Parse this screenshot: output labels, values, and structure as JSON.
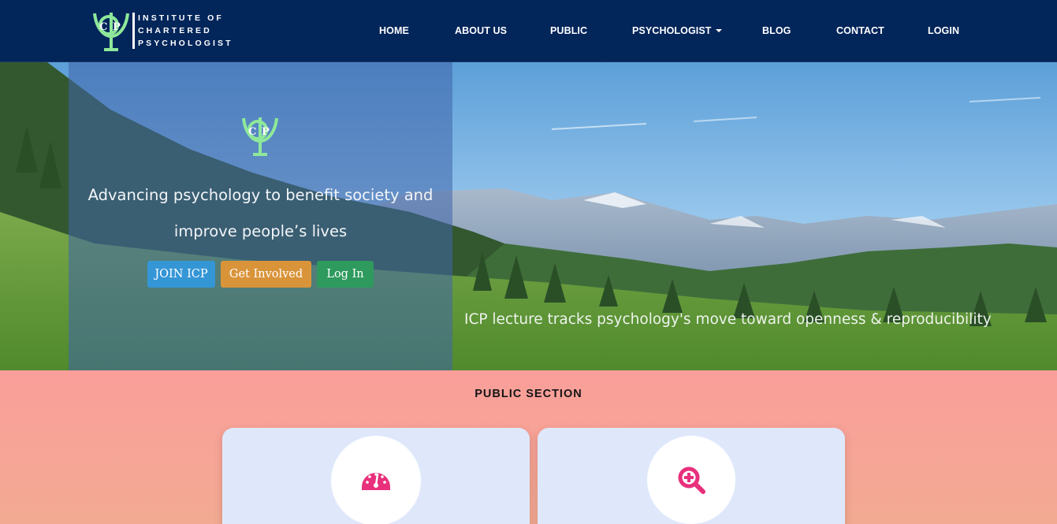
{
  "brand": {
    "logo_text": [
      "INSTITUTE OF",
      "CHARTERED",
      "PSYCHOLOGIST"
    ],
    "colors": {
      "navy": "#02255a",
      "logo_green": "#8ee89a",
      "accent_pink": "#e8307c"
    }
  },
  "nav": {
    "items": [
      {
        "label": "HOME"
      },
      {
        "label": "ABOUT US"
      },
      {
        "label": "PUBLIC"
      },
      {
        "label": "PSYCHOLOGIST",
        "dropdown": true
      },
      {
        "label": "BLOG"
      },
      {
        "label": "CONTACT"
      },
      {
        "label": "LOGIN"
      }
    ]
  },
  "hero": {
    "tagline_line1": "Advancing psychology to benefit society and",
    "tagline_line2": "improve people’s lives",
    "buttons": {
      "join": "JOIN ICP",
      "involved": "Get Involved",
      "login": "Log In"
    },
    "caption": "ICP lecture tracks psychology's move toward openness & reproducibility"
  },
  "public_section": {
    "title": "PUBLIC SECTION",
    "cards": [
      {
        "icon": "speedometer-icon"
      },
      {
        "icon": "zoom-in-icon"
      }
    ]
  }
}
